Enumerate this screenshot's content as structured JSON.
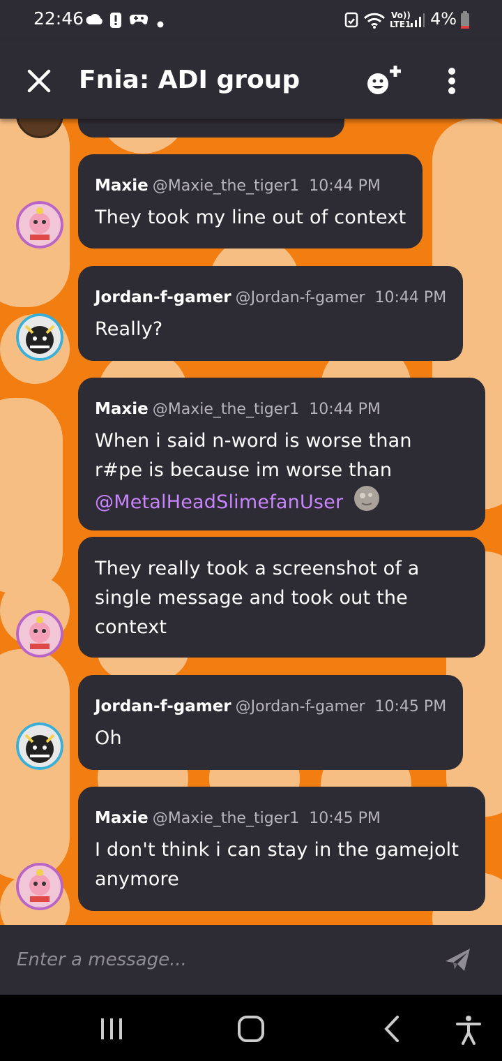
{
  "status_bar": {
    "time": "22:46",
    "battery": "4%",
    "network": "LTE1",
    "volte": "Vo))",
    "icons": [
      "cloud-icon",
      "alert-icon",
      "game-controller-icon",
      "dot-icon",
      "alarm-icon",
      "wifi-icon",
      "signal-icon",
      "battery-icon"
    ]
  },
  "header": {
    "title": "Fnia: ADI group",
    "close_icon": "close-icon",
    "add_member_icon": "add-member-icon",
    "more_icon": "more-options-icon"
  },
  "messages": [
    {
      "author": "Maxie",
      "handle": "@Maxie_the_tiger1",
      "time": "10:44 PM",
      "lines": [
        "They took my line out of context"
      ]
    },
    {
      "author": "Jordan-f-gamer",
      "handle": "@Jordan-f-gamer",
      "time": "10:44 PM",
      "lines": [
        "Really?"
      ]
    },
    {
      "author": "Maxie",
      "handle": "@Maxie_the_tiger1",
      "time": "10:44 PM",
      "lines": [
        "When i said n-word is worse than",
        "r#pe is because im worse than"
      ],
      "mention": "@MetalHeadSlimefanUser"
    },
    {
      "author": "",
      "handle": "",
      "time": "",
      "lines": [
        "They really took a screenshot of a",
        "single message and took out the",
        "context"
      ]
    },
    {
      "author": "Jordan-f-gamer",
      "handle": "@Jordan-f-gamer",
      "time": "10:45 PM",
      "lines": [
        "Oh"
      ]
    },
    {
      "author": "Maxie",
      "handle": "@Maxie_the_tiger1",
      "time": "10:45 PM",
      "lines": [
        "I don't think i can stay in the gamejolt",
        "anymore"
      ]
    }
  ],
  "composer": {
    "placeholder": "Enter a message...",
    "send_icon": "send-icon"
  },
  "nav": {
    "icons": [
      "recent-apps-icon",
      "home-icon",
      "back-icon",
      "accessibility-icon"
    ]
  },
  "colors": {
    "background_orange": "#f27d10",
    "background_pattern": "#f6be82",
    "bubble": "#2d2b33",
    "bar": "#2d2b33",
    "mention": "#c985ff",
    "secondary_text": "#b7b4bd"
  }
}
